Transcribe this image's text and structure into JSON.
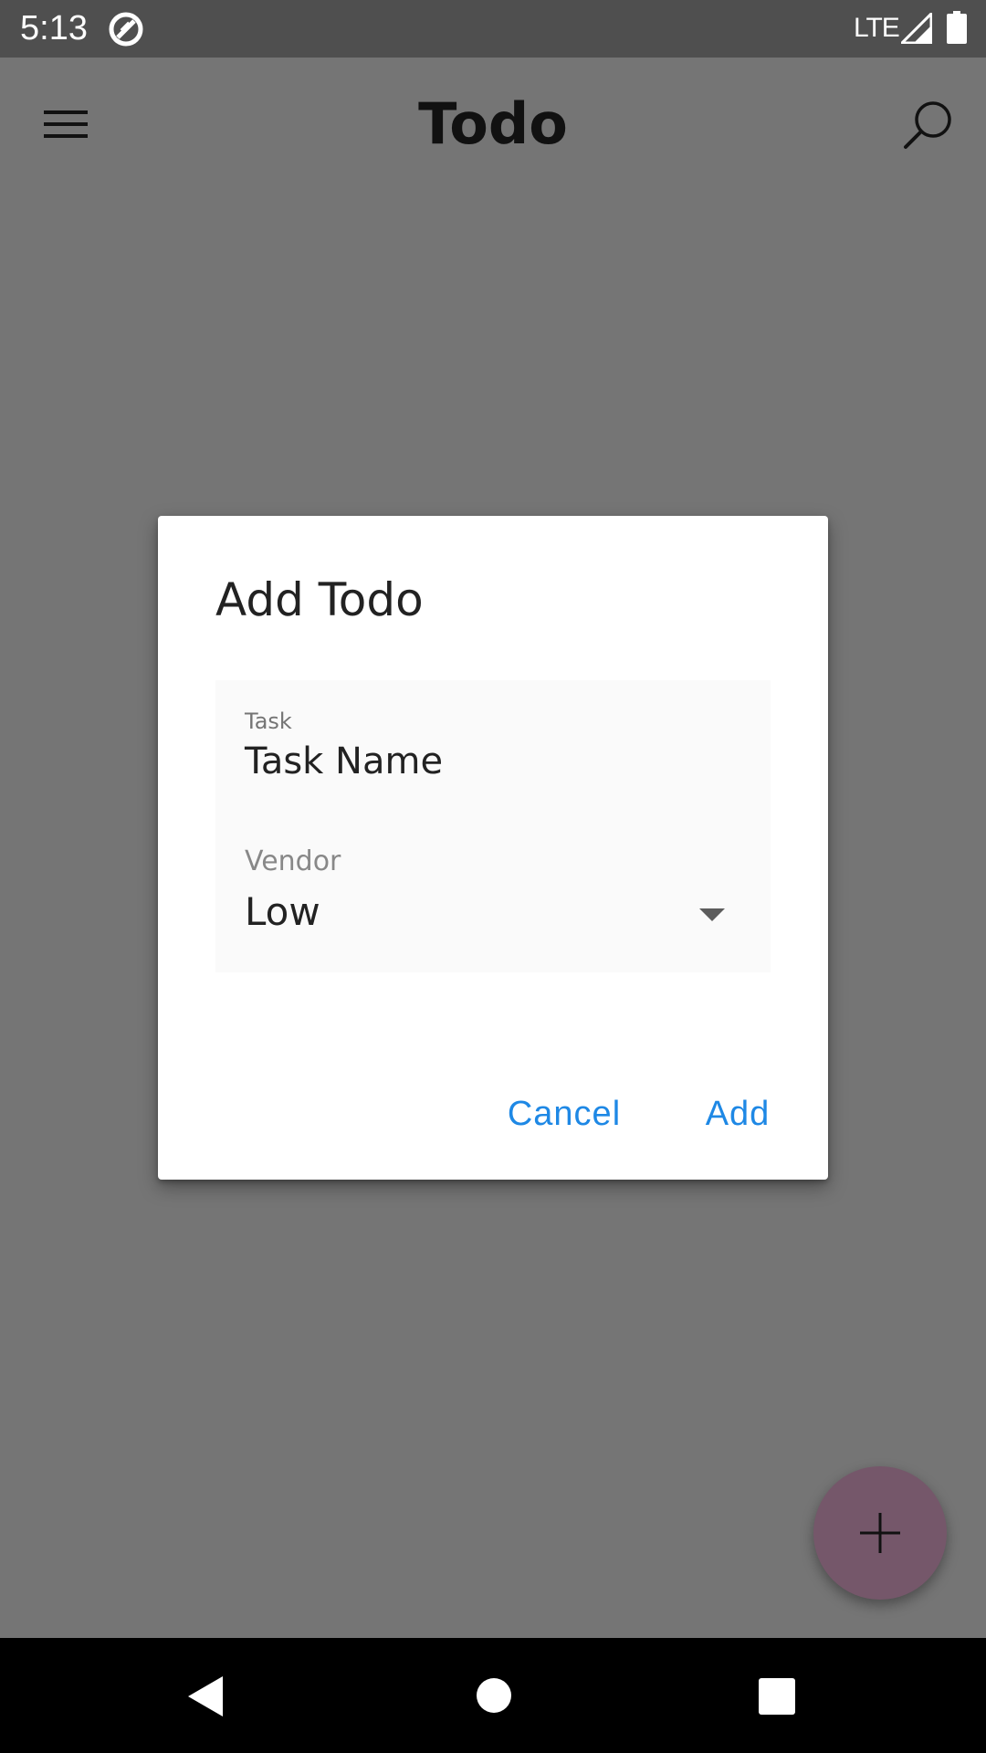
{
  "status_bar": {
    "time": "5:13",
    "network": "LTE",
    "icons": [
      "data-saver-icon",
      "signal-icon",
      "battery-icon"
    ]
  },
  "app_bar": {
    "title": "Todo",
    "icons": [
      "menu-icon",
      "search-icon"
    ]
  },
  "dialog": {
    "title": "Add Todo",
    "task_label": "Task",
    "task_value": "Task Name",
    "vendor_label": "Vendor",
    "vendor_value": "Low",
    "cancel_label": "Cancel",
    "add_label": "Add"
  },
  "fab": {
    "icon": "plus-icon"
  },
  "nav_bar": {
    "icons": [
      "back-icon",
      "home-icon",
      "recents-icon"
    ]
  },
  "colors": {
    "scrim": "#757575",
    "accent": "#1e88e5",
    "fab": "#75576a"
  }
}
